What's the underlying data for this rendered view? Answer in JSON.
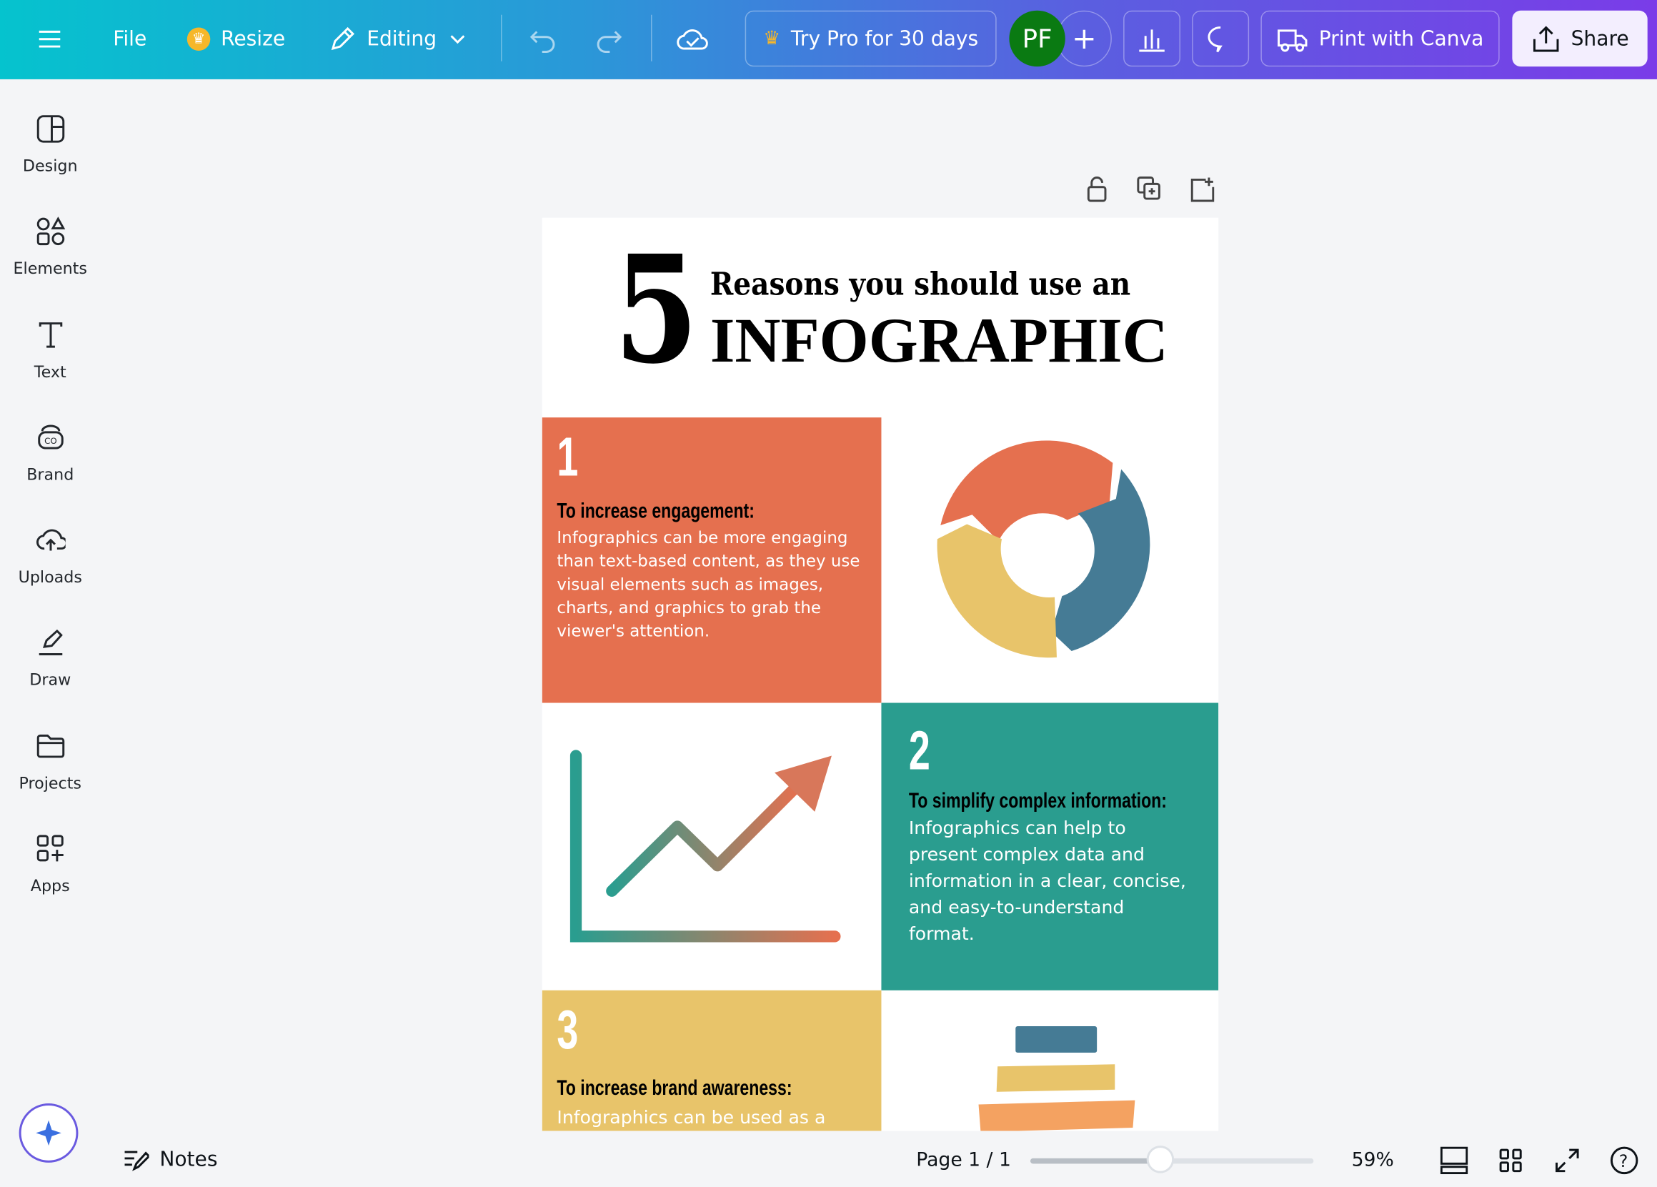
{
  "topbar": {
    "menu_icon": "hamburger-icon",
    "file": "File",
    "resize": "Resize",
    "editing": "Editing",
    "try_pro": "Try Pro for 30 days",
    "avatar": "PF",
    "print": "Print with Canva",
    "share": "Share"
  },
  "sidebar": {
    "items": [
      {
        "label": "Design",
        "icon": "design-icon"
      },
      {
        "label": "Elements",
        "icon": "elements-icon"
      },
      {
        "label": "Text",
        "icon": "text-icon"
      },
      {
        "label": "Brand",
        "icon": "brand-icon"
      },
      {
        "label": "Uploads",
        "icon": "cloud-upload-icon"
      },
      {
        "label": "Draw",
        "icon": "pen-icon"
      },
      {
        "label": "Projects",
        "icon": "folder-icon"
      },
      {
        "label": "Apps",
        "icon": "apps-icon"
      }
    ]
  },
  "design": {
    "big_number": "5",
    "title_line1": "Reasons you should use an",
    "title_line2": "INFOGRAPHIC",
    "sections": [
      {
        "number": "1",
        "heading": "To increase engagement:",
        "text": "Infographics can be more engaging than text-based content, as they use visual elements such as images, charts, and graphics to grab the viewer's attention."
      },
      {
        "number": "2",
        "heading": "To simplify complex information:",
        "text": "Infographics can help to present complex data and information in a clear, concise, and easy-to-understand format."
      },
      {
        "number": "3",
        "heading": "To increase brand awareness:",
        "text": "Infographics can be used as a marketing tool to increase"
      }
    ],
    "colors": {
      "orange": "#e5704f",
      "teal": "#2a9d8f",
      "yellow": "#e8c46a",
      "blue": "#457b95",
      "light_orange": "#f4a261"
    }
  },
  "bottombar": {
    "notes": "Notes",
    "page": "Page 1 / 1",
    "zoom": "59%",
    "zoom_fraction": 0.46
  }
}
